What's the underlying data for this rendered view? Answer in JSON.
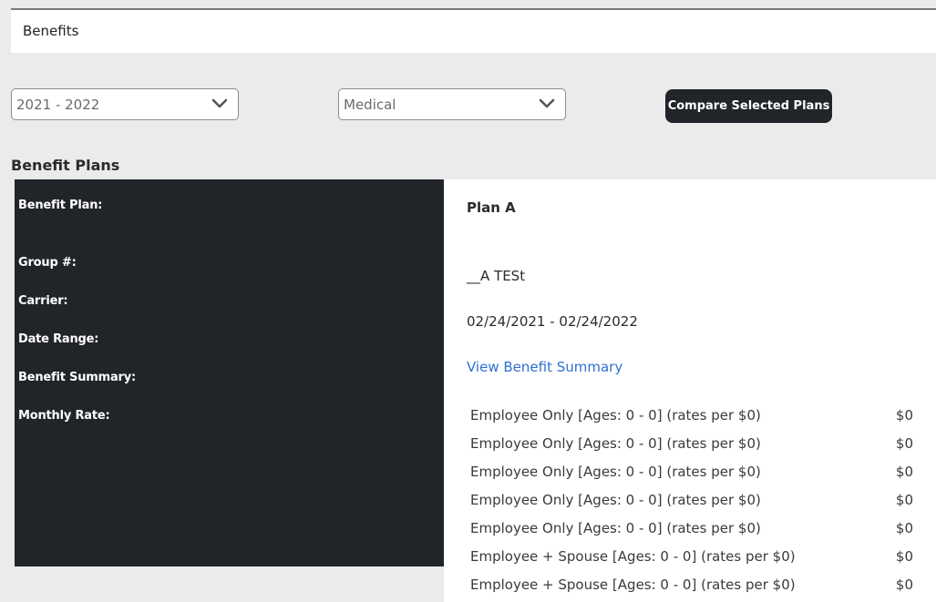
{
  "header": {
    "title": "Benefits"
  },
  "filters": {
    "year": {
      "value": "2021 - 2022"
    },
    "type": {
      "value": "Medical"
    },
    "compare_label": "Compare Selected Plans"
  },
  "section_title": "Benefit Plans",
  "labels": {
    "benefit_plan": "Benefit Plan:",
    "group": "Group #:",
    "carrier": "Carrier:",
    "date_range": "Date Range:",
    "benefit_summary": "Benefit Summary:",
    "monthly_rate": "Monthly Rate:"
  },
  "plan": {
    "name": "Plan A",
    "group": "",
    "carrier": "__A TESt",
    "date_range": "02/24/2021 - 02/24/2022",
    "summary_link": "View Benefit Summary",
    "rates": [
      {
        "label": "Employee Only [Ages: 0 - 0] (rates per $0)",
        "amount": "$0"
      },
      {
        "label": "Employee Only [Ages: 0 - 0] (rates per $0)",
        "amount": "$0"
      },
      {
        "label": "Employee Only [Ages: 0 - 0] (rates per $0)",
        "amount": "$0"
      },
      {
        "label": "Employee Only [Ages: 0 - 0] (rates per $0)",
        "amount": "$0"
      },
      {
        "label": "Employee Only [Ages: 0 - 0] (rates per $0)",
        "amount": "$0"
      },
      {
        "label": "Employee + Spouse [Ages: 0 - 0] (rates per $0)",
        "amount": "$0"
      },
      {
        "label": "Employee + Spouse [Ages: 0 - 0] (rates per $0)",
        "amount": "$0"
      }
    ]
  },
  "colors": {
    "dark_panel": "#212429",
    "link": "#2f6fd1",
    "background": "#ebebeb"
  }
}
